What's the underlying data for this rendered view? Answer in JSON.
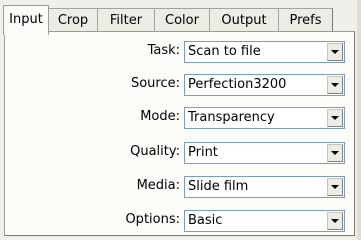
{
  "tabs": [
    {
      "label": "Input",
      "active": true
    },
    {
      "label": "Crop",
      "active": false
    },
    {
      "label": "Filter",
      "active": false
    },
    {
      "label": "Color",
      "active": false
    },
    {
      "label": "Output",
      "active": false
    },
    {
      "label": "Prefs",
      "active": false
    }
  ],
  "fields": [
    {
      "label": "Task:",
      "value": "Scan to file"
    },
    {
      "label": "Source:",
      "value": "Perfection3200"
    },
    {
      "label": "Mode:",
      "value": "Transparency"
    },
    {
      "label": "Quality:",
      "value": "Print"
    },
    {
      "label": "Media:",
      "value": "Slide film"
    },
    {
      "label": "Options:",
      "value": "Basic"
    }
  ],
  "colors": {
    "panel_bg": "#fbfbf8",
    "window_bg": "#f0f0ea",
    "combo_border": "#7f9db9"
  }
}
